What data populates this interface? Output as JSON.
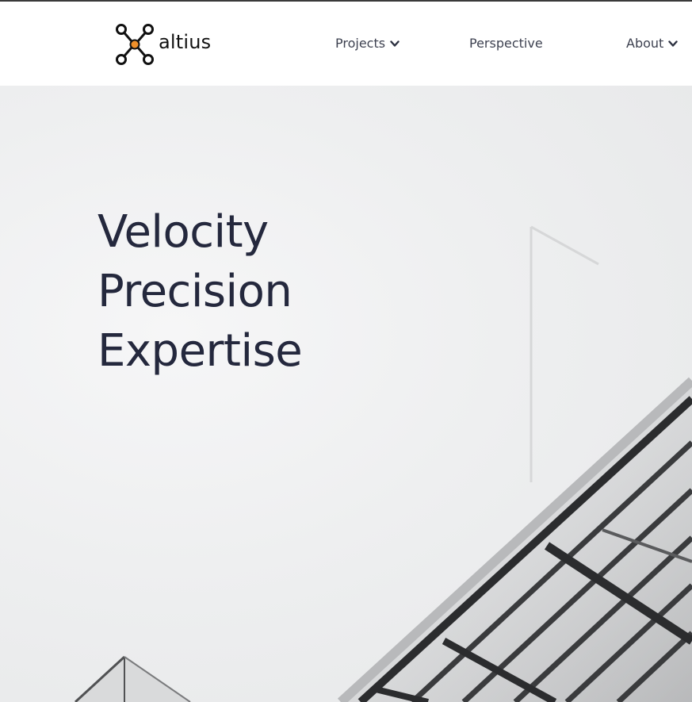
{
  "brand": {
    "name": "altius",
    "logo_icon": "molecule-logo-icon",
    "accent_color": "#f0902a"
  },
  "nav": {
    "items": [
      {
        "label": "Projects",
        "has_dropdown": true
      },
      {
        "label": "Perspective",
        "has_dropdown": false
      },
      {
        "label": "About",
        "has_dropdown": true
      }
    ]
  },
  "hero": {
    "lines": [
      "Velocity",
      "Precision",
      "Expertise"
    ],
    "text_color": "#24283d",
    "background_image": "grayscale-architecture-photo"
  }
}
